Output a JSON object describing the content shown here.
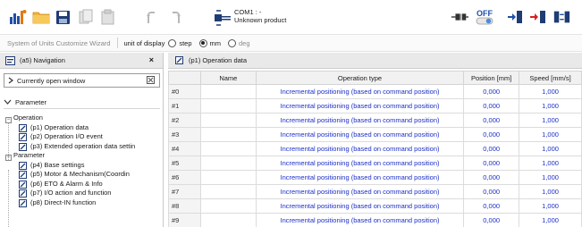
{
  "toolbar": {
    "icons": [
      "graph-icon",
      "folder-icon",
      "save-icon",
      "copy-icon",
      "paste-icon",
      "undo-icon",
      "redo-icon"
    ],
    "com_port": "COM1 : -",
    "product": "Unknown product",
    "right_icons": [
      "connect-icon",
      "off-toggle-icon",
      "download-icon",
      "upload-icon",
      "verify-icon"
    ],
    "off_label": "OFF"
  },
  "units": {
    "wizard": "System of Units Customize Wizard",
    "unit_of_display": "unit of display",
    "options": [
      "step",
      "mm",
      "deg"
    ],
    "selected": "mm"
  },
  "nav": {
    "title": "(a5) Navigation",
    "close": "×",
    "current_open": "Currently open window",
    "section": "Parameter",
    "tree": [
      {
        "type": "group",
        "label": "Operation"
      },
      {
        "type": "leaf",
        "label": "(p1) Operation data"
      },
      {
        "type": "leaf",
        "label": "(p2) Operation I/O event"
      },
      {
        "type": "leaf",
        "label": "(p3) Extended operation data settin"
      },
      {
        "type": "group",
        "label": "Parameter"
      },
      {
        "type": "leaf",
        "label": "(p4) Base settings"
      },
      {
        "type": "leaf",
        "label": "(p5) Motor & Mechanism(Coordin"
      },
      {
        "type": "leaf",
        "label": "(p6) ETO & Alarm & Info"
      },
      {
        "type": "leaf",
        "label": "(p7) I/O action and function"
      },
      {
        "type": "leaf",
        "label": "(p8) Direct-IN function"
      }
    ]
  },
  "main": {
    "title": "(p1) Operation data",
    "columns": [
      "",
      "Name",
      "Operation type",
      "Position [mm]",
      "Speed [mm/s]"
    ],
    "rows": [
      {
        "id": "#0",
        "name": "",
        "type": "Incremental positioning (based on command position)",
        "position": "0,000",
        "speed": "1,000"
      },
      {
        "id": "#1",
        "name": "",
        "type": "Incremental positioning (based on command position)",
        "position": "0,000",
        "speed": "1,000"
      },
      {
        "id": "#2",
        "name": "",
        "type": "Incremental positioning (based on command position)",
        "position": "0,000",
        "speed": "1,000"
      },
      {
        "id": "#3",
        "name": "",
        "type": "Incremental positioning (based on command position)",
        "position": "0,000",
        "speed": "1,000"
      },
      {
        "id": "#4",
        "name": "",
        "type": "Incremental positioning (based on command position)",
        "position": "0,000",
        "speed": "1,000"
      },
      {
        "id": "#5",
        "name": "",
        "type": "Incremental positioning (based on command position)",
        "position": "0,000",
        "speed": "1,000"
      },
      {
        "id": "#6",
        "name": "",
        "type": "Incremental positioning (based on command position)",
        "position": "0,000",
        "speed": "1,000"
      },
      {
        "id": "#7",
        "name": "",
        "type": "Incremental positioning (based on command position)",
        "position": "0,000",
        "speed": "1,000"
      },
      {
        "id": "#8",
        "name": "",
        "type": "Incremental positioning (based on command position)",
        "position": "0,000",
        "speed": "1,000"
      },
      {
        "id": "#9",
        "name": "",
        "type": "Incremental positioning (based on command position)",
        "position": "0,000",
        "speed": "1,000"
      }
    ]
  }
}
